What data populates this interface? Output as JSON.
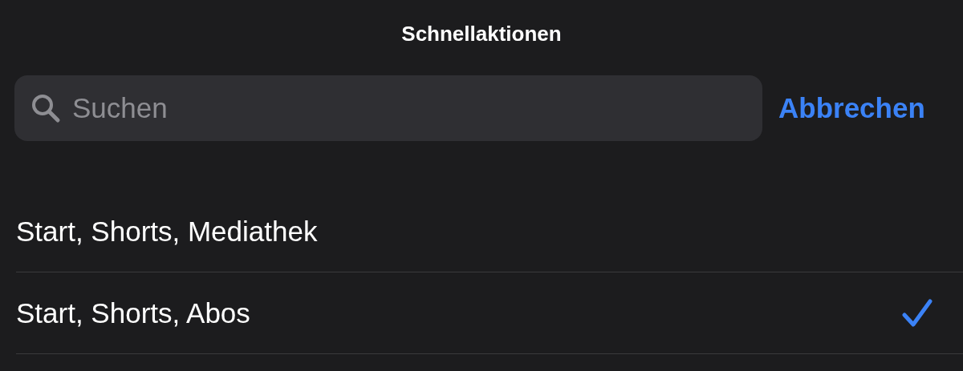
{
  "title": "Schnellaktionen",
  "search": {
    "placeholder": "Suchen"
  },
  "cancel_button": "Abbrechen",
  "options": [
    {
      "label": "Start, Shorts, Mediathek",
      "selected": false
    },
    {
      "label": "Start, Shorts, Abos",
      "selected": true
    }
  ]
}
